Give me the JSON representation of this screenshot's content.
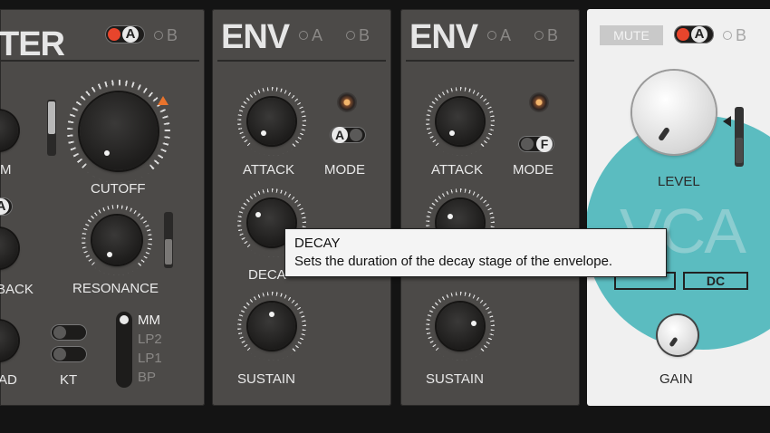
{
  "filter_panel": {
    "title": "TER",
    "ab_active": "A",
    "ab_inactive": "B",
    "labels": {
      "cutoff": "CUTOFF",
      "resonance": "RESONANCE",
      "m_partial": "M",
      "back_partial": "BACK",
      "ad_partial": "AD",
      "kt": "KT",
      "a_partial": "A"
    },
    "modes": [
      "MM",
      "LP2",
      "LP1",
      "BP"
    ],
    "active_mode": "MM",
    "accent_color": "#e8732c"
  },
  "env1": {
    "title": "ENV",
    "ab": [
      "A",
      "B"
    ],
    "labels": {
      "attack": "ATTACK",
      "mode": "MODE",
      "decay": "DECA",
      "sustain": "SUSTAIN"
    },
    "mode_value": "A"
  },
  "env2": {
    "title": "ENV",
    "ab": [
      "A",
      "B"
    ],
    "labels": {
      "attack": "ATTACK",
      "mode": "MODE",
      "sustain": "SUSTAIN"
    },
    "mode_value": "F"
  },
  "vca_panel": {
    "mute": "MUTE",
    "ab_active": "A",
    "ab_inactive": "B",
    "title": "VCA",
    "level": "LEVEL",
    "gain": "GAIN",
    "dc": "DC",
    "accent_color": "#5bbcc0"
  },
  "tooltip": {
    "title": "DECAY",
    "description": "Sets the duration of the decay stage of the envelope."
  }
}
